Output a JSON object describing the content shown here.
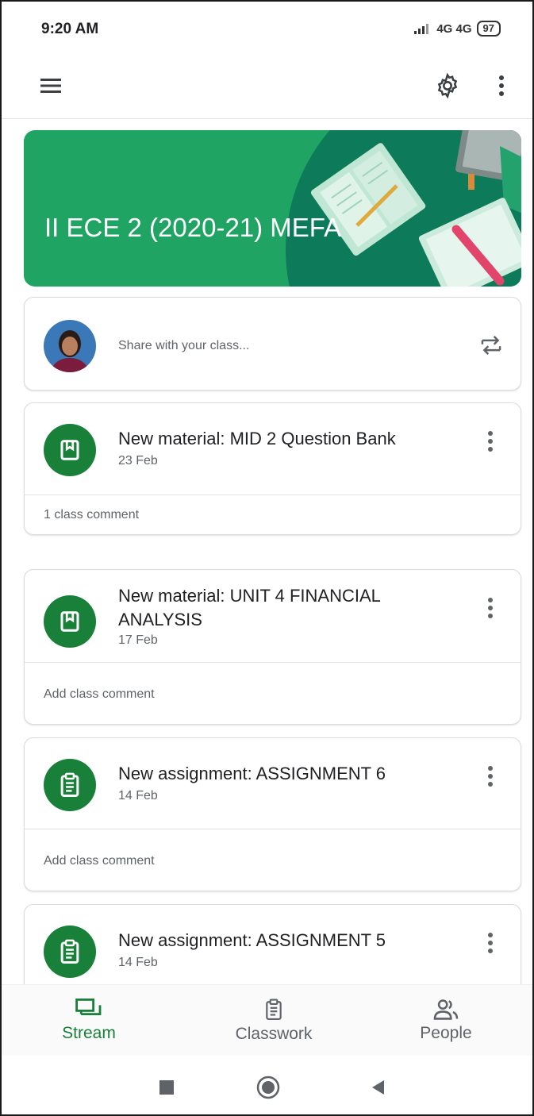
{
  "status_bar": {
    "time": "9:20 AM",
    "network": "4G 4G",
    "battery": "97"
  },
  "app_bar": {
    "menu_icon": "menu-icon",
    "settings_icon": "gear-icon",
    "more_icon": "more-vert-icon"
  },
  "banner": {
    "title": "II ECE 2 (2020-21)  MEFA",
    "color": "#1fa463"
  },
  "share": {
    "placeholder": "Share with your class..."
  },
  "posts": [
    {
      "title": "New material: MID 2 Question Bank",
      "date": "23 Feb",
      "comment": "1 class comment",
      "type": "material"
    },
    {
      "title": "New material: UNIT 4 FINANCIAL ANALYSIS",
      "date": "17 Feb",
      "comment": "Add class comment",
      "type": "material"
    },
    {
      "title": "New assignment: ASSIGNMENT 6",
      "date": "14 Feb",
      "comment": "Add class comment",
      "type": "assignment"
    },
    {
      "title": "New assignment: ASSIGNMENT 5",
      "date": "14 Feb",
      "type": "assignment"
    }
  ],
  "bottom_nav": {
    "items": [
      {
        "label": "Stream",
        "icon": "stream-icon",
        "active": true
      },
      {
        "label": "Classwork",
        "icon": "classwork-icon",
        "active": false
      },
      {
        "label": "People",
        "icon": "people-icon",
        "active": false
      }
    ]
  },
  "colors": {
    "accent": "#188038",
    "banner": "#1fa463"
  }
}
